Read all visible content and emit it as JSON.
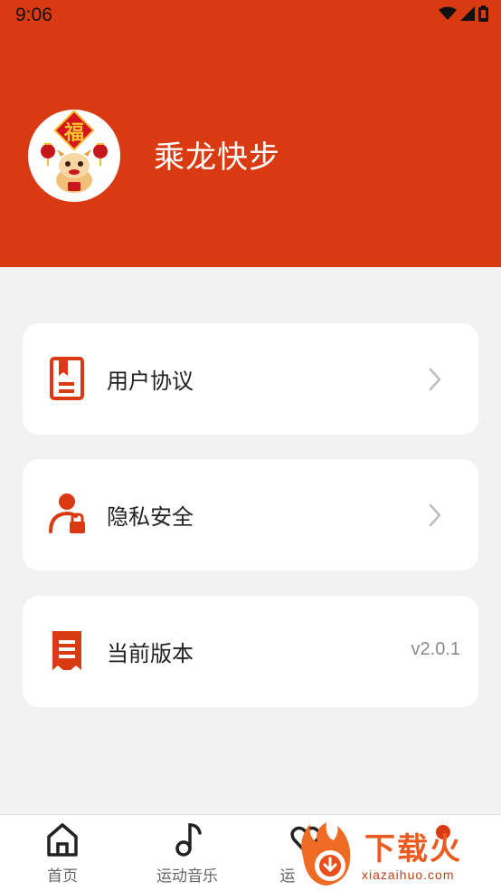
{
  "status_bar": {
    "time": "9:06"
  },
  "profile": {
    "app_name": "乘龙快步"
  },
  "menu": {
    "user_agreement": {
      "label": "用户协议"
    },
    "privacy": {
      "label": "隐私安全"
    },
    "version": {
      "label": "当前版本",
      "value": "v2.0.1"
    }
  },
  "tabbar": {
    "tabs": [
      {
        "label": "首页"
      },
      {
        "label": "运动音乐"
      },
      {
        "label": "运"
      }
    ]
  },
  "watermark": {
    "text": "下载火",
    "url": "xiazaihuo.com"
  },
  "colors": {
    "brand": "#d93a12",
    "background": "#f2f2f2",
    "icon": "#d93a12"
  }
}
